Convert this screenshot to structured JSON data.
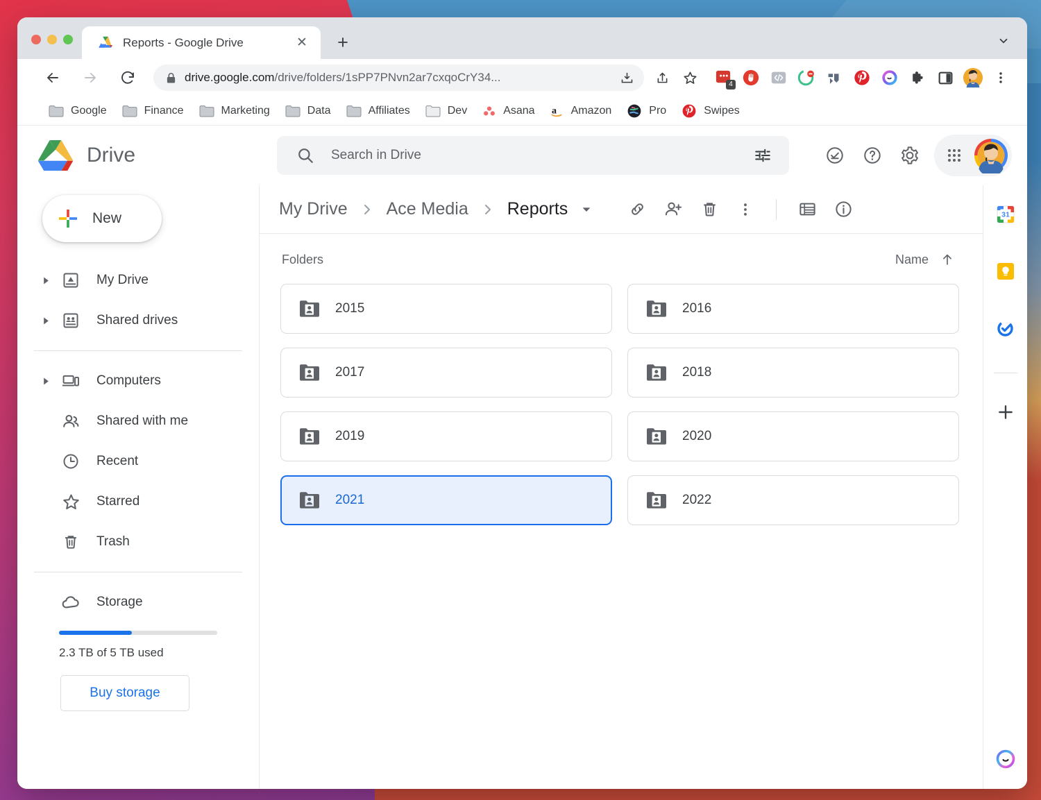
{
  "window": {
    "traffic_lights": [
      "close",
      "minimize",
      "maximize"
    ],
    "tab": {
      "title": "Reports - Google Drive",
      "close_label": "✕",
      "favicon": "google-drive-icon"
    },
    "new_tab_label": "+",
    "tab_list_chevron": "chevron-down-icon"
  },
  "omnibox": {
    "lock": "lock-icon",
    "url_domain": "drive.google.com",
    "url_path": "/drive/folders/1sPP7PNvn2ar7cxqoCrY34...",
    "icons": [
      "download-icon",
      "share-icon",
      "bookmark-star-icon"
    ],
    "extensions": [
      {
        "name": "notes-extension",
        "badge": "4"
      },
      {
        "name": "adblock-extension",
        "badge": ""
      },
      {
        "name": "code-extension",
        "badge": ""
      },
      {
        "name": "grammar-extension",
        "badge": ""
      },
      {
        "name": "trello-extension",
        "badge": ""
      },
      {
        "name": "pinterest-extension",
        "badge": ""
      },
      {
        "name": "ai-assistant-extension",
        "badge": ""
      },
      {
        "name": "puzzle-extensions-icon",
        "badge": ""
      },
      {
        "name": "side-panel-icon",
        "badge": ""
      },
      {
        "name": "profile-avatar",
        "badge": ""
      },
      {
        "name": "chrome-menu-icon",
        "badge": ""
      }
    ]
  },
  "bookmarks": [
    {
      "label": "Google",
      "icon": "folder-icon"
    },
    {
      "label": "Finance",
      "icon": "folder-icon"
    },
    {
      "label": "Marketing",
      "icon": "folder-icon"
    },
    {
      "label": "Data",
      "icon": "folder-icon"
    },
    {
      "label": "Affiliates",
      "icon": "folder-icon"
    },
    {
      "label": "Dev",
      "icon": "folder-icon"
    },
    {
      "label": "Asana",
      "icon": "asana-icon"
    },
    {
      "label": "Amazon",
      "icon": "amazon-icon"
    },
    {
      "label": "Pro",
      "icon": "globe-icon"
    },
    {
      "label": "Swipes",
      "icon": "pinterest-icon"
    }
  ],
  "drive": {
    "brand": "Drive",
    "search": {
      "placeholder": "Search in Drive",
      "search_icon": "search-icon",
      "tune_icon": "tune-icon"
    },
    "header_icons": [
      "tasks-check-icon",
      "help-icon",
      "settings-gear-icon",
      "apps-grid-icon",
      "account-avatar"
    ]
  },
  "sidebar": {
    "new_button": "New",
    "items": [
      {
        "label": "My Drive",
        "icon": "my-drive-icon",
        "expandable": true
      },
      {
        "label": "Shared drives",
        "icon": "shared-drives-icon",
        "expandable": true
      },
      {
        "label": "Computers",
        "icon": "computers-icon",
        "expandable": true
      },
      {
        "label": "Shared with me",
        "icon": "people-icon",
        "expandable": false
      },
      {
        "label": "Recent",
        "icon": "clock-icon",
        "expandable": false
      },
      {
        "label": "Starred",
        "icon": "star-icon",
        "expandable": false
      },
      {
        "label": "Trash",
        "icon": "trash-icon",
        "expandable": false
      }
    ],
    "storage": {
      "label": "Storage",
      "icon": "cloud-icon",
      "used_text": "2.3 TB of 5 TB used",
      "percent": 46,
      "buy_button": "Buy storage",
      "accent_color": "#1a73e8"
    }
  },
  "breadcrumb": {
    "items": [
      "My Drive",
      "Ace Media",
      "Reports"
    ],
    "separator": "›",
    "dropdown_icon": "caret-down-icon",
    "tools": [
      "link-icon",
      "add-person-icon",
      "trash-icon",
      "more-vertical-icon",
      "list-view-icon",
      "info-icon"
    ]
  },
  "content": {
    "section_title": "Folders",
    "sort_label": "Name",
    "sort_direction_icon": "arrow-up-icon",
    "folders": [
      {
        "name": "2015",
        "icon": "shared-folder-icon",
        "selected": false
      },
      {
        "name": "2016",
        "icon": "shared-folder-icon",
        "selected": false
      },
      {
        "name": "2017",
        "icon": "shared-folder-icon",
        "selected": false
      },
      {
        "name": "2018",
        "icon": "shared-folder-icon",
        "selected": false
      },
      {
        "name": "2019",
        "icon": "shared-folder-icon",
        "selected": false
      },
      {
        "name": "2020",
        "icon": "shared-folder-icon",
        "selected": false
      },
      {
        "name": "2021",
        "icon": "shared-folder-icon",
        "selected": true
      },
      {
        "name": "2022",
        "icon": "shared-folder-icon",
        "selected": false
      }
    ],
    "selected_folder": "2021",
    "selection_bg": "#e8f0fe",
    "selection_border": "#1b6feb",
    "selection_text": "#1967d2"
  },
  "right_rail": {
    "items": [
      "google-calendar-icon",
      "google-keep-icon",
      "google-tasks-icon"
    ],
    "add_label": "+",
    "bottom_icon": "assistant-blob-icon"
  }
}
